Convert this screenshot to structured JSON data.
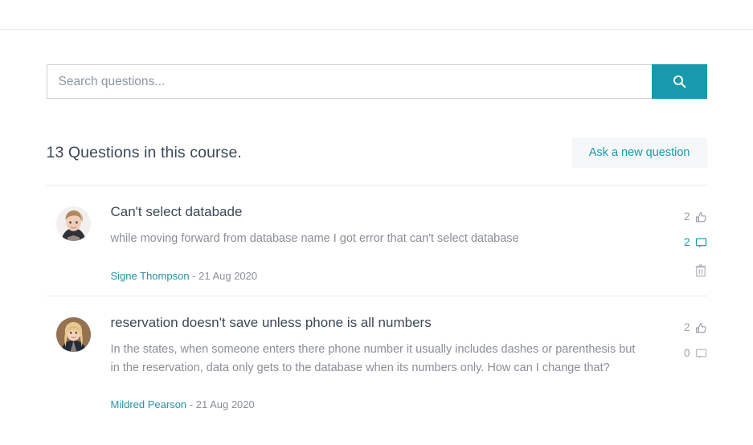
{
  "topbar": {
    "present": true
  },
  "search": {
    "placeholder": "Search questions...",
    "value": "",
    "button_icon": "search-icon",
    "button_color": "#1899ad"
  },
  "header": {
    "title": "13 Questions in this course.",
    "ask_button_label": "Ask a new question",
    "ask_button_color": "#1899ad",
    "ask_button_bg": "#f6f7f8"
  },
  "questions": [
    {
      "avatar": "woman-short-blonde-hair-white-background",
      "title": "Can't select databade",
      "body": "while moving forward from database name I got error that can't select database",
      "author": "Signe Thompson",
      "separator": "-",
      "date": "21 Aug 2020",
      "likes": "2",
      "likes_icon": "thumbs-up-icon",
      "comments": "2",
      "comments_icon": "comment-icon",
      "comments_highlight": true,
      "has_delete": true,
      "delete_icon": "trash-icon"
    },
    {
      "avatar": "woman-long-blonde-hair-brown-background",
      "title": "reservation doesn't save unless phone is all numbers",
      "body": "In the states, when someone enters there phone number it usually includes dashes or parenthesis but in the reservation, data only gets to the database when its numbers only. How can I change that?",
      "author": "Mildred Pearson",
      "separator": "-",
      "date": "21 Aug 2020",
      "likes": "2",
      "likes_icon": "thumbs-up-icon",
      "comments": "0",
      "comments_icon": "comment-icon",
      "comments_highlight": false,
      "has_delete": false,
      "delete_icon": "trash-icon"
    }
  ]
}
